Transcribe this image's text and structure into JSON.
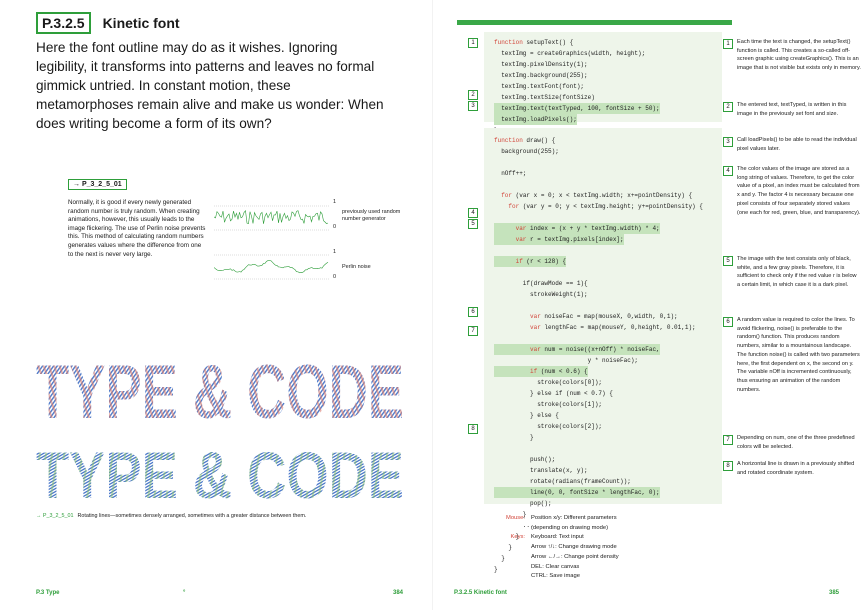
{
  "left": {
    "section_id": "P.3.2.5",
    "section_title": "Kinetic font",
    "intro": "Here the font outline may do as it wishes. Ignoring legibility, it transforms into patterns and leaves no formal gimmick untried. In constant motion, these metamorphoses remain alive and make us wonder: When does writing become a form of its own?",
    "example_tag": "→ P_3_2_5_01",
    "example_text": "Normally, it is good if every newly generated random number is truly random. When creating animations, however, this usually leads to the image flickering. The use of Perlin noise prevents this. This method of calculating random numbers generates values where the difference from one to the next is never very large.",
    "graph1": {
      "axis_top": "1",
      "axis_bottom": "0",
      "label": "previously used random number generator"
    },
    "graph2": {
      "axis_top": "1",
      "axis_bottom": "0",
      "label": "Perlin noise"
    },
    "art_text": "TYPE & CODE",
    "caption_id": "→ P_3_2_5_01",
    "caption": "Rotating lines—sometimes densely arranged, sometimes with a greater distance between them.",
    "footer_section": "P.3 Type",
    "footer_mark": "°",
    "page_number": "384"
  },
  "right": {
    "code1": [
      "function setupText() {",
      "  textImg = createGraphics(width, height);",
      "  textImg.pixelDensity(1);",
      "  textImg.background(255);",
      "  textImg.textFont(font);",
      "  textImg.textSize(fontSize)",
      "  textImg.text(textTyped, 100, fontSize + 50);",
      "  textImg.loadPixels();",
      "}"
    ],
    "code2": [
      "function draw() {",
      "  background(255);",
      "",
      "  nOff++;",
      "",
      "  for (var x = 0; x < textImg.width; x+=pointDensity) {",
      "    for (var y = 0; y < textImg.height; y+=pointDensity) {",
      "",
      "      var index = (x + y * textImg.width) * 4;",
      "      var r = textImg.pixels[index];",
      "",
      "      if (r < 128) {",
      "",
      "        if(drawMode == 1){",
      "          strokeWeight(1);",
      "",
      "          var noiseFac = map(mouseX, 0,width, 0,1);",
      "          var lengthFac = map(mouseY, 0,height, 0.01,1);",
      "",
      "          var num = noise((x+nOff) * noiseFac,",
      "                          y * noiseFac);",
      "          if (num < 0.6) {",
      "            stroke(colors[0]);",
      "          } else if (num < 0.7) {",
      "            stroke(colors[1]);",
      "          } else {",
      "            stroke(colors[2]);",
      "          }",
      "",
      "          push();",
      "          translate(x, y);",
      "          rotate(radians(frameCount));",
      "          line(0, 0, fontSize * lengthFac, 0);",
      "          pop();",
      "        }",
      "        ...",
      "      }",
      "    }",
      "  }",
      "}"
    ],
    "notes": [
      {
        "n": "1",
        "text": "Each time the text is changed, the setupText() function is called. This creates a so-called off-screen graphic using createGraphics(). This is an image that is not visible but exists only in memory."
      },
      {
        "n": "2",
        "text": "The entered text, textTyped, is written in this image in the previously set font and size."
      },
      {
        "n": "3",
        "text": "Call loadPixels() to be able to read the individual pixel values later."
      },
      {
        "n": "4",
        "text": "The color values of the image are stored as a long string of values. Therefore, to get the color value of a pixel, an index must be calculated from x and y. The factor 4 is necessary because one pixel consists of four separately stored values (one each for red, green, blue, and transparency)."
      },
      {
        "n": "5",
        "text": "The image with the text consists only of black, white, and a few gray pixels. Therefore, it is sufficient to check only if the red value r is below a certain limit, in which case it is a dark pixel."
      },
      {
        "n": "6",
        "text": "A random value is required to color the lines. To avoid flickering, noise() is preferable to the random() function. This produces random numbers, similar to a mountainous landscape. The function noise() is called with two parameters here, the first dependent on x, the second on y. The variable nOff is incremented continuously, thus ensuring an animation of the random numbers."
      },
      {
        "n": "7",
        "text": "Depending on num, one of the three predefined colors will be selected."
      },
      {
        "n": "8",
        "text": "A horizontal line is drawn in a previously shifted and rotated coordinate system."
      }
    ],
    "help": [
      {
        "key": "Mouse:",
        "value": "Position x/y: Different parameters"
      },
      {
        "key": "",
        "value": "(depending on drawing mode)"
      },
      {
        "key": "Keys:",
        "value": "Keyboard: Text input"
      },
      {
        "key": "",
        "value": "Arrow ↑/↓: Change drawing mode"
      },
      {
        "key": "",
        "value": "Arrow ←/→: Change point density"
      },
      {
        "key": "",
        "value": "DEL: Clear canvas"
      },
      {
        "key": "",
        "value": "CTRL: Save image"
      }
    ],
    "footer_section": "P.3.2.5 Kinetic font",
    "page_number": "385"
  },
  "colors": {
    "accent": "#2e9e3a",
    "code_bg": "#eef5ea",
    "keyword": "#d2453a",
    "art_blue": "#4c79c9",
    "art_red": "#e07a6a",
    "art_green": "#8ac470"
  }
}
